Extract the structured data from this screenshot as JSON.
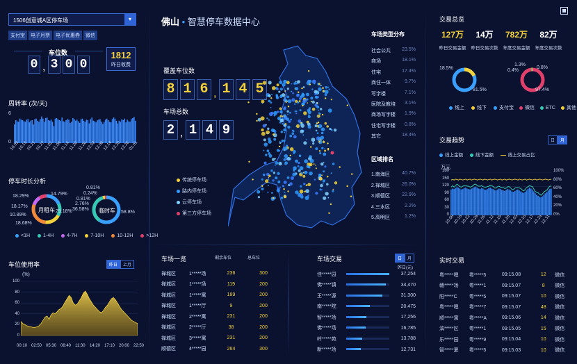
{
  "left": {
    "lot_select": "1506创意城A区停车场",
    "payment_tags": [
      "支付宝",
      "电子月票",
      "电子优惠券",
      "微信"
    ],
    "spaces_label": "车位数",
    "spaces_digits": [
      "0",
      ",",
      "3",
      "0",
      "0"
    ],
    "yesterday_income": "1812",
    "yesterday_income_label": "昨日收费",
    "turnover_title": "周转率 (次/天)",
    "turnover_ymax": "6",
    "turnover_ymin": "0",
    "turnover_xlabels": [
      "10.09",
      "10.15",
      "10.21",
      "10.27",
      "11.02",
      "11.08",
      "11.14",
      "11.20",
      "11.26",
      "12.02",
      "12.08",
      "12.14",
      "12.20",
      "12.26",
      "01.01"
    ],
    "duration_title": "停车时长分析",
    "ring1_label": "月租车",
    "ring1_pcts": [
      "18.29%",
      "14.79%",
      "18.17%",
      "29.18%",
      "10.89%",
      "18.68%"
    ],
    "ring2_label": "临时车",
    "ring2_pcts": [
      "0.81%",
      "0.24%",
      "0.81%",
      "2.76%",
      "36.58%",
      "58.8%"
    ],
    "duration_legend": [
      "<1H",
      "1-4H",
      "4-7H",
      "7-10H",
      "10-12H",
      ">12H"
    ],
    "usage_title": "车位使用率",
    "usage_btns": [
      "昨日",
      "上月"
    ],
    "usage_unit": "(%)",
    "usage_yticks": [
      "100",
      "80",
      "60",
      "40",
      "20",
      "0"
    ],
    "usage_xlabels": [
      "00:10",
      "02:50",
      "05:30",
      "08:40",
      "11:30",
      "14:20",
      "17:10",
      "20:00",
      "22:50"
    ]
  },
  "center": {
    "city": "佛山",
    "title": "智慧停车数据中心",
    "covered_label": "覆盖车位数",
    "covered_digits": [
      "8",
      "1",
      "6",
      ",",
      "1",
      "4",
      "5"
    ],
    "total_lots_label": "车场总数",
    "total_lots_digits": [
      "2",
      ",",
      "1",
      "4",
      "9"
    ],
    "map_legend": [
      {
        "label": "传统停车场",
        "color": "#f2d13a"
      },
      {
        "label": "路内停车场",
        "color": "#2f9bff"
      },
      {
        "label": "云停车场",
        "color": "#7fd0ff"
      },
      {
        "label": "第三方停车场",
        "color": "#e0406a"
      }
    ],
    "type_title": "车场类型分布",
    "types": [
      {
        "name": "社会公共",
        "pct": "23.5%"
      },
      {
        "name": "商场",
        "pct": "18.1%"
      },
      {
        "name": "住宅",
        "pct": "17.4%"
      },
      {
        "name": "商住一体",
        "pct": "9.7%"
      },
      {
        "name": "写字楼",
        "pct": "7.1%"
      },
      {
        "name": "医院及教培",
        "pct": "3.1%"
      },
      {
        "name": "商场写字楼",
        "pct": "1.9%"
      },
      {
        "name": "住宅写字楼",
        "pct": "0.8%"
      },
      {
        "name": "其它",
        "pct": "18.4%"
      }
    ],
    "rank_title": "区域排名",
    "ranks": [
      {
        "name": "1.南海区",
        "pct": "40.7%"
      },
      {
        "name": "2.禅城区",
        "pct": "26.0%"
      },
      {
        "name": "3.顺德区",
        "pct": "22.9%"
      },
      {
        "name": "4.三水区",
        "pct": "2.2%"
      },
      {
        "name": "5.高明区",
        "pct": "1.2%"
      }
    ]
  },
  "lot_list": {
    "title": "车场一览",
    "headers": [
      "剩余车位",
      "总车位"
    ],
    "rows": [
      [
        "禅城区",
        "1*****场",
        "236",
        "300"
      ],
      [
        "禅城区",
        "1*****场",
        "119",
        "200"
      ],
      [
        "禅城区",
        "1*****寓",
        "189",
        "200"
      ],
      [
        "禅城区",
        "1*****厅",
        "9",
        "200"
      ],
      [
        "禅城区",
        "2*****寓",
        "231",
        "200"
      ],
      [
        "禅城区",
        "2*****厅",
        "38",
        "200"
      ],
      [
        "禅城区",
        "3*****寓",
        "231",
        "200"
      ],
      [
        "顺德区",
        "4*****园",
        "264",
        "300"
      ]
    ]
  },
  "lot_trade": {
    "title": "车场交易",
    "btns": [
      "日",
      "月"
    ],
    "unit": "昨日(元)",
    "rows": [
      {
        "name": "佳*****园",
        "value": "37,254",
        "fill": 1.0
      },
      {
        "name": "佛*****镇",
        "value": "34,470",
        "fill": 0.92
      },
      {
        "name": "王*****源",
        "value": "31,300",
        "fill": 0.84
      },
      {
        "name": "南*****院",
        "value": "20,475",
        "fill": 0.55
      },
      {
        "name": "智*****场",
        "value": "17,256",
        "fill": 0.46
      },
      {
        "name": "佛*****场",
        "value": "16,785",
        "fill": 0.45
      },
      {
        "name": "岭*****苑",
        "value": "13,788",
        "fill": 0.37
      },
      {
        "name": "新*****场",
        "value": "12,731",
        "fill": 0.34
      }
    ]
  },
  "right": {
    "overview_title": "交易总览",
    "stats": [
      {
        "value": "127万",
        "label": "昨日交易金额",
        "color": "#f2d13a"
      },
      {
        "value": "14万",
        "label": "昨日交易次数",
        "color": "#ffffff"
      },
      {
        "value": "782万",
        "label": "年度交易金额",
        "color": "#f2d13a"
      },
      {
        "value": "82万",
        "label": "年度交易次数",
        "color": "#ffffff"
      }
    ],
    "donut1_pcts": [
      "18.5%",
      "81.5%"
    ],
    "donut1_legend": [
      "线上",
      "线下"
    ],
    "donut2_pcts": [
      "1.3%",
      "0.4%",
      "0.8%",
      "97.4%"
    ],
    "donut2_legend": [
      "支付宝",
      "微信",
      "ETC",
      "其他"
    ],
    "trend_title": "交易趋势",
    "trend_btns": [
      "日",
      "月"
    ],
    "trend_legend": [
      "线上金额",
      "线下金额",
      "线上交易占比"
    ],
    "trend_unit": "万元",
    "trend_yticks": [
      "180",
      "150",
      "120",
      "90",
      "60",
      "30",
      "0"
    ],
    "trend_y2ticks": [
      "100%",
      "80%",
      "60%",
      "40%",
      "20%",
      "0%"
    ],
    "trend_xlabels": [
      "10.08",
      "10.15",
      "10.22",
      "10.29",
      "11.05",
      "11.12",
      "11.19",
      "11.26",
      "12.03",
      "12.10",
      "12.17",
      "12.24",
      "12.31"
    ],
    "rt_title": "实时交易",
    "rt_rows": [
      [
        "粤*****嗯",
        "粤*****5",
        "09:15.08",
        "12",
        "微信"
      ],
      [
        "赣*****场",
        "粤*****1",
        "09:15.07",
        "8",
        "微信"
      ],
      [
        "阳*****C",
        "粤*****5",
        "09:15.07",
        "10",
        "微信"
      ],
      [
        "粤*****嗯",
        "粤*****7",
        "09:15.07",
        "48",
        "微信"
      ],
      [
        "顺*****寓",
        "粤*****A",
        "09:15.06",
        "14",
        "微信"
      ],
      [
        "滨*****区",
        "粤*****1",
        "09:15.05",
        "15",
        "微信"
      ],
      [
        "乐*****园",
        "粤*****9",
        "09:15.04",
        "10",
        "微信"
      ],
      [
        "智*****夏",
        "粤*****5",
        "09:15.03",
        "10",
        "微信"
      ]
    ]
  },
  "chart_data": [
    {
      "type": "bar",
      "title": "周转率 (次/天)",
      "ylim": [
        0,
        6
      ],
      "values": [
        3.5,
        4.3,
        4.1,
        4.0,
        4.6,
        4.4,
        4.3,
        4.1,
        4.0,
        4.4,
        4.5,
        3.9,
        4.2,
        4.3,
        3.5,
        4.5,
        4.6,
        4.2,
        4.0,
        4.5,
        5.0,
        4.6,
        4.0,
        4.7,
        4.8,
        4.3,
        4.2,
        4.4,
        4.0,
        3.2,
        4.6,
        4.7,
        4.5,
        4.3,
        4.2,
        4.8,
        4.1,
        4.0,
        4.3,
        4.5,
        4.4,
        3.8,
        4.0,
        4.7,
        4.5,
        4.2,
        4.4,
        4.1,
        3.8,
        4.5,
        4.6,
        4.2,
        4.0,
        4.4,
        4.3,
        3.7,
        4.5,
        4.8,
        4.2,
        4.1,
        3.9,
        4.3,
        4.4,
        4.5,
        4.0,
        3.6,
        4.0,
        4.4,
        4.6,
        4.3,
        4.0,
        3.9,
        4.5,
        4.8,
        4.6,
        4.2,
        3.7,
        4.2,
        4.0,
        4.5,
        4.3,
        4.6,
        3.9,
        4.4,
        4.1,
        4.0,
        4.5,
        4.7,
        4.9,
        4.2
      ]
    },
    {
      "type": "area",
      "title": "车位使用率",
      "ylim": [
        0,
        100
      ],
      "values": [
        26,
        22,
        20,
        18,
        17,
        16,
        15,
        15,
        16,
        18,
        22,
        28,
        34,
        36,
        30,
        38,
        42,
        40,
        44,
        48,
        50,
        55,
        62,
        68,
        74,
        70,
        60,
        56,
        58,
        64,
        70,
        78,
        82,
        76,
        68,
        62,
        56,
        52,
        48,
        44,
        42,
        46,
        52,
        56,
        62,
        68,
        70,
        66,
        60,
        54,
        48,
        44,
        40,
        36,
        32,
        28,
        26,
        24,
        22
      ]
    },
    {
      "type": "bar",
      "title": "交易趋势",
      "ylim": [
        0,
        180
      ],
      "series": [
        {
          "name": "线上金额",
          "values": [
            108,
            112,
            110,
            114,
            118,
            116,
            112,
            108,
            110,
            114,
            116,
            112,
            110,
            108,
            112,
            114,
            118,
            120,
            116,
            112,
            110,
            114,
            112,
            108,
            106,
            110,
            114,
            116,
            112,
            110,
            106,
            104,
            108,
            112,
            110,
            106,
            104,
            102,
            106,
            110,
            108,
            104,
            100,
            98,
            102,
            106,
            108,
            104,
            100,
            96,
            94,
            98,
            104,
            110,
            116,
            112,
            108,
            100,
            92,
            86,
            82,
            78,
            76,
            80,
            86,
            92,
            98,
            104,
            110,
            112
          ]
        },
        {
          "name": "线下金额",
          "values": [
            30,
            28,
            32,
            30,
            28,
            30,
            32,
            30,
            28,
            30,
            32,
            30,
            28,
            30,
            32,
            30,
            28,
            30,
            32,
            30,
            28,
            30,
            32,
            30,
            28,
            30,
            32,
            30,
            28,
            30,
            32,
            30,
            28,
            30,
            32,
            30,
            28,
            30,
            32,
            30,
            28,
            30,
            32,
            30,
            28,
            30,
            32,
            30,
            28,
            30,
            32,
            30,
            28,
            30,
            32,
            30,
            28,
            30,
            32,
            30,
            28,
            30,
            32,
            30,
            28,
            30,
            32,
            30,
            28,
            30
          ]
        },
        {
          "name": "线上交易占比",
          "values": [
            82,
            83,
            82,
            84,
            83,
            82,
            84,
            83,
            82,
            83,
            84,
            82,
            83,
            84,
            82,
            83,
            84,
            83,
            82,
            83,
            84,
            83,
            82,
            84,
            83,
            82,
            83,
            84,
            82,
            83,
            84,
            83,
            82,
            83,
            84,
            82,
            83,
            84,
            82,
            83,
            84,
            83,
            82,
            83,
            84,
            83,
            82,
            84,
            83,
            82,
            83,
            84,
            82,
            83,
            84,
            83,
            82,
            83,
            84,
            82,
            83,
            84,
            83,
            82,
            83,
            84,
            83,
            82,
            83,
            84
          ]
        }
      ]
    }
  ]
}
